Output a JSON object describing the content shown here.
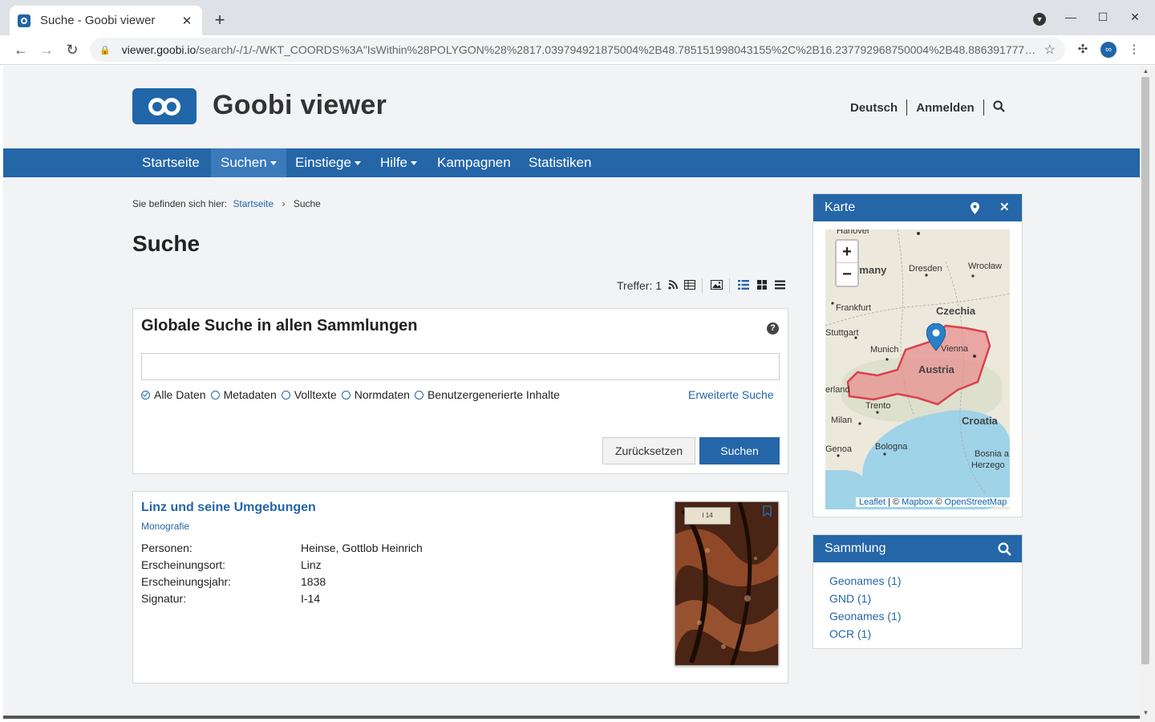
{
  "browser": {
    "tab_title": "Suche - Goobi viewer",
    "tab_close": "✕",
    "new_tab": "+",
    "url_host": "viewer.goobi.io",
    "url_path": "/search/-/1/-/WKT_COORDS%3A\"IsWithin%28POLYGON%28%2817.039794921875004%2B48.785151998043155%2C%2B16.237792968750004%2B48.886391777…",
    "window_controls": [
      "—",
      "☐",
      "✕"
    ]
  },
  "header": {
    "brand": "Goobi viewer",
    "lang": "Deutsch",
    "login": "Anmelden"
  },
  "nav": {
    "items": [
      {
        "label": "Startseite",
        "dropdown": false
      },
      {
        "label": "Suchen",
        "dropdown": true
      },
      {
        "label": "Einstiege",
        "dropdown": true
      },
      {
        "label": "Hilfe",
        "dropdown": true
      },
      {
        "label": "Kampagnen",
        "dropdown": false
      },
      {
        "label": "Statistiken",
        "dropdown": false
      }
    ]
  },
  "breadcrumb": {
    "prefix": "Sie befinden sich hier:",
    "home": "Startseite",
    "separator": "›",
    "current": "Suche"
  },
  "page": {
    "title": "Suche",
    "hits_label": "Treffer: 1"
  },
  "search": {
    "heading": "Globale Suche in allen Sammlungen",
    "help": "?",
    "input_value": "",
    "options": [
      "Alle Daten",
      "Metadaten",
      "Volltexte",
      "Normdaten",
      "Benutzergenerierte Inhalte"
    ],
    "selected": "Alle Daten",
    "advanced_link": "Erweiterte Suche",
    "reset_label": "Zurücksetzen",
    "submit_label": "Suchen"
  },
  "result": {
    "title": "Linz und seine Umgebungen",
    "type": "Monografie",
    "metadata": [
      {
        "key": "Personen:",
        "value": "Heinse, Gottlob Heinrich"
      },
      {
        "key": "Erscheinungsort:",
        "value": "Linz"
      },
      {
        "key": "Erscheinungsjahr:",
        "value": "1838"
      },
      {
        "key": "Signatur:",
        "value": "I-14"
      }
    ],
    "thumb_label": "I 14"
  },
  "map_widget": {
    "title": "Karte",
    "zoom_in": "+",
    "zoom_out": "−",
    "labels": {
      "hanover": "Hanover",
      "germany": "Germany",
      "dresden": "Dresden",
      "wroclaw": "Wrocław",
      "frankfurt": "Frankfurt",
      "czechia": "Czechia",
      "stuttgart": "Stuttgart",
      "munich": "Munich",
      "vienna": "Vienna",
      "austria": "Austria",
      "erland": "erland",
      "trento": "Trento",
      "milan": "Milan",
      "croatia": "Croatia",
      "genoa": "Genoa",
      "bologna": "Bologna",
      "bosnia": "Bosnia a",
      "herzego": "Herzego"
    },
    "attribution": {
      "leaflet": "Leaflet",
      "sep1": " | © ",
      "mapbox": "Mapbox",
      "sep2": " © ",
      "osm": "OpenStreetMap"
    },
    "colors": {
      "polygon_fill": "#e88a8a",
      "polygon_stroke": "#d9414e",
      "marker": "#2a80c6"
    }
  },
  "collection_widget": {
    "title": "Sammlung",
    "items": [
      "Geonames (1)",
      "GND (1)",
      "Geonames (1)",
      "OCR (1)"
    ]
  },
  "colors": {
    "primary": "#2466a8",
    "background": "#f2f3f5"
  }
}
